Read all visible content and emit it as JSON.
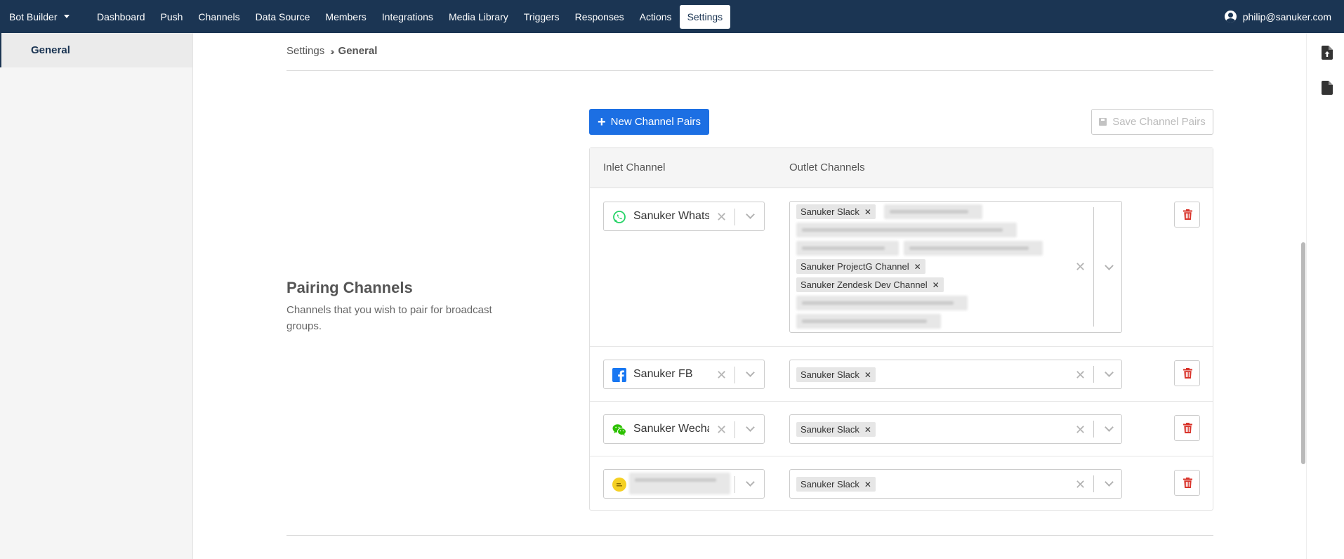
{
  "nav": {
    "brand": "Bot Builder",
    "items": [
      "Dashboard",
      "Push",
      "Channels",
      "Data Source",
      "Members",
      "Integrations",
      "Media Library",
      "Triggers",
      "Responses",
      "Actions",
      "Settings"
    ],
    "active": "Settings",
    "user_email": "philip@sanuker.com"
  },
  "sidebar": {
    "items": [
      {
        "label": "General"
      }
    ]
  },
  "breadcrumb": {
    "parent": "Settings",
    "current": "General"
  },
  "section": {
    "title": "Pairing Channels",
    "description": "Channels that you wish to pair for broadcast groups."
  },
  "buttons": {
    "new_pairs": "New Channel Pairs",
    "save_pairs": "Save Channel Pairs"
  },
  "table": {
    "headers": {
      "inlet": "Inlet Channel",
      "outlet": "Outlet Channels"
    },
    "rows": [
      {
        "inlet": "Sanuker WhatsApp",
        "inlet_icon": "whatsapp-icon",
        "outlets": [
          "Sanuker Slack",
          "Sanuker ProjectG Channel",
          "Sanuker Zendesk Dev Channel"
        ]
      },
      {
        "inlet": "Sanuker FB",
        "inlet_icon": "facebook-icon",
        "outlets": [
          "Sanuker Slack"
        ]
      },
      {
        "inlet": "Sanuker Wechat",
        "inlet_icon": "wechat-icon",
        "outlets": [
          "Sanuker Slack"
        ]
      },
      {
        "inlet": "",
        "inlet_icon": "chat-bubble-icon",
        "outlets": [
          "Sanuker Slack"
        ]
      }
    ]
  },
  "colors": {
    "nav_bg": "#1b3553",
    "primary": "#1c6fe3",
    "danger": "#d9342b",
    "whatsapp": "#25d366",
    "facebook": "#1877f2",
    "wechat": "#2dc100"
  }
}
